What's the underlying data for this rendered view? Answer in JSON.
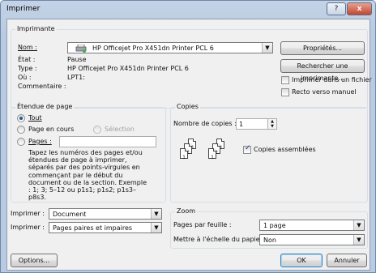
{
  "window": {
    "title": "Imprimer",
    "help_glyph": "?",
    "close_glyph": "x"
  },
  "printer": {
    "group_label": "Imprimante",
    "name_label": "Nom :",
    "name_value": "HP Officejet Pro X451dn Printer PCL 6",
    "status_label": "État :",
    "status_value": "Pause",
    "type_label": "Type :",
    "type_value": "HP Officejet Pro X451dn Printer PCL 6",
    "where_label": "Où :",
    "where_value": "LPT1:",
    "comment_label": "Commentaire :",
    "properties_button": "Propriétés...",
    "find_button": "Rechercher une imprimante...",
    "print_to_file": "Imprimer dans un fichier",
    "manual_duplex": "Recto verso manuel"
  },
  "range": {
    "group_label": "Étendue de page",
    "all": "Tout",
    "current": "Page en cours",
    "selection": "Sélection",
    "pages": "Pages :",
    "help": "Tapez les numéros des pages et/ou étendues de page à imprimer, séparés par des points-virgules en commençant par le début du document ou de la section. Exemple : 1; 3; 5–12 ou p1s1; p1s2; p1s3–p8s3."
  },
  "copies": {
    "group_label": "Copies",
    "count_label": "Nombre de copies :",
    "count_value": "1",
    "collate": "Copies assemblées",
    "page_numbers": [
      "3",
      "2",
      "1",
      "3",
      "2",
      "1"
    ]
  },
  "print_what": {
    "label": "Imprimer :",
    "value": "Document"
  },
  "print": {
    "label": "Imprimer :",
    "value": "Pages paires et impaires"
  },
  "zoom": {
    "group_label": "Zoom",
    "pages_per_sheet_label": "Pages par feuille :",
    "pages_per_sheet_value": "1 page",
    "scale_label": "Mettre à l'échelle du papier :",
    "scale_value": "Non"
  },
  "footer": {
    "options_button": "Options...",
    "ok_button": "OK",
    "cancel_button": "Annuler"
  }
}
